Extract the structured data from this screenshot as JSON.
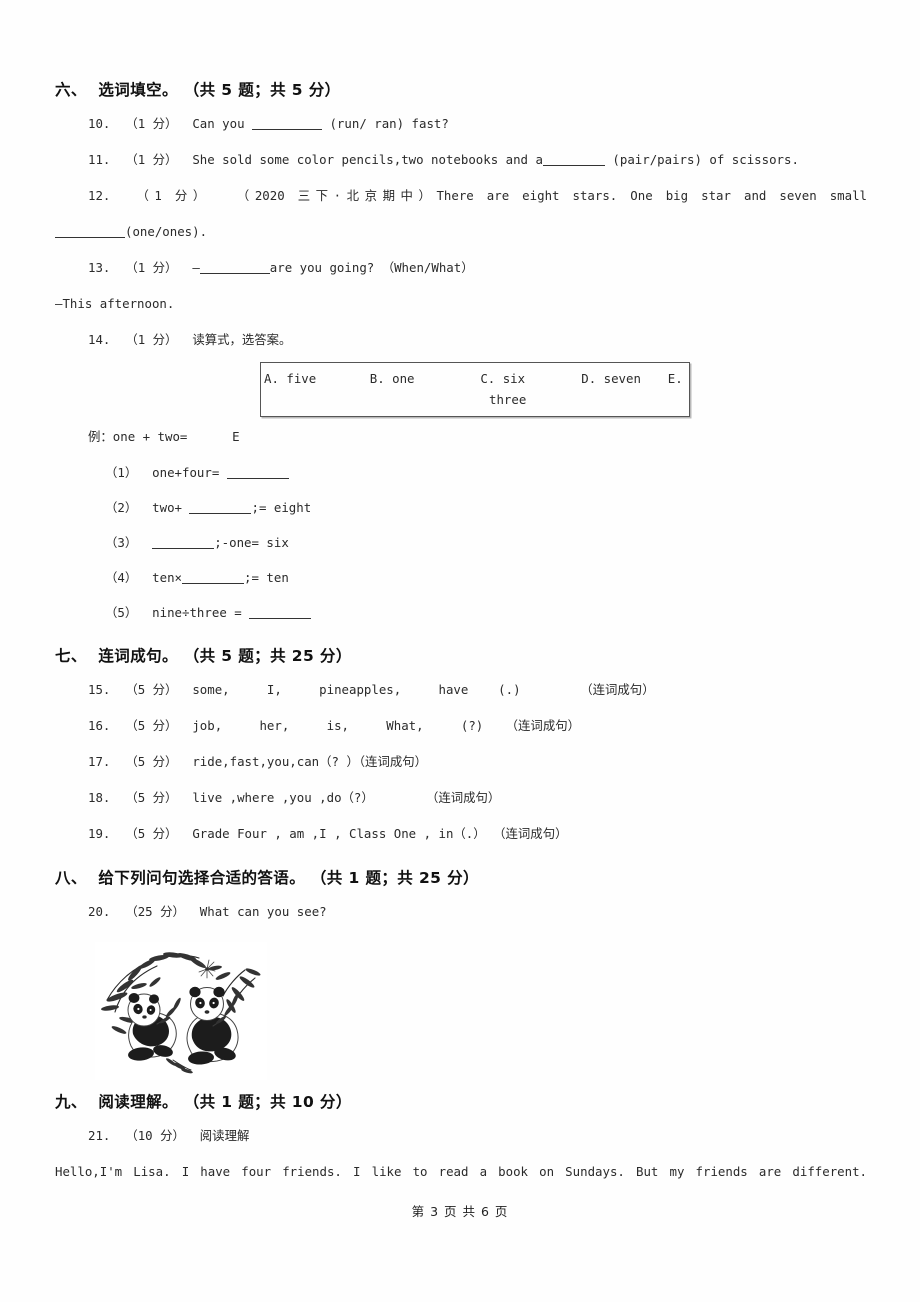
{
  "page": {
    "footer": "第 3 页 共 6 页",
    "number": 3,
    "total": 6
  },
  "sections": [
    {
      "id": "six",
      "number": "六、",
      "title": "选词填空。",
      "meta": "（共 5 题；共 5 分）",
      "heading": "六、  选词填空。 （共 5 题；共 5 分）"
    },
    {
      "id": "seven",
      "number": "七、",
      "title": "连词成句。",
      "meta": "（共 5 题；共 25 分）",
      "heading": "七、  连词成句。 （共 5 题；共 25 分）"
    },
    {
      "id": "eight",
      "number": "八、",
      "title": "给下列问句选择合适的答语。",
      "meta": "（共 1 题；共 25 分）",
      "heading": "八、  给下列问句选择合适的答语。 （共 1 题；共 25 分）"
    },
    {
      "id": "nine",
      "number": "九、",
      "title": "阅读理解。",
      "meta": "（共 1 题；共 10 分）",
      "heading": "九、  阅读理解。 （共 1 题；共 10 分）"
    }
  ],
  "q10": {
    "num": "10.",
    "points": "（1 分）",
    "text_before": "Can you ",
    "text_after": " (run/ ran) fast?"
  },
  "q11": {
    "num": "11.",
    "points": "（1 分）",
    "text_before": "She sold some color pencils,two notebooks and a",
    "text_after": " (pair/pairs) of scissors."
  },
  "q12": {
    "num": "12.",
    "points": "（1 分）",
    "tag": "（2020 三下·北京期中）",
    "line1": "There are eight stars. One big star and seven small",
    "line2_after": "(one/ones)."
  },
  "q13": {
    "num": "13.",
    "points": "（1 分）",
    "dash": "—",
    "text_after": "are you going? （When/What）",
    "answer_line": "—This afternoon."
  },
  "q14": {
    "num": "14.",
    "points": "（1 分）",
    "text": "读算式，选答案。",
    "options": [
      {
        "key": "A.",
        "label": "A. five"
      },
      {
        "key": "B.",
        "label": "B. one"
      },
      {
        "key": "C.",
        "label": "C. six"
      },
      {
        "key": "D.",
        "label": "D. seven"
      },
      {
        "key": "E.",
        "label": "E."
      }
    ],
    "option_wrap": "three",
    "example": "例：one + two=      E",
    "subs": [
      {
        "label": "（1）",
        "before": " one+four= ",
        "after": ""
      },
      {
        "label": "（2）",
        "before": " two+ ",
        "after": ";= eight"
      },
      {
        "label": "（3）",
        "before": " ",
        "after": ";-one= six"
      },
      {
        "label": "（4）",
        "before": " ten×",
        "after": ";= ten"
      },
      {
        "label": "（5）",
        "before": " nine÷three = ",
        "after": ""
      }
    ]
  },
  "q15": {
    "num": "15.",
    "points": "（5 分）",
    "words": "some,     I,     pineapples,     have    (.)",
    "instruction": "（连词成句）"
  },
  "q16": {
    "num": "16.",
    "points": "（5 分）",
    "words": "job,     her,     is,     What,     (?)",
    "instruction": "（连词成句）"
  },
  "q17": {
    "num": "17.",
    "points": "（5 分）",
    "words": "ride,fast,you,can（? ）",
    "instruction": "（连词成句）"
  },
  "q18": {
    "num": "18.",
    "points": "（5 分）",
    "words": "live ,where ,you ,do（?）",
    "instruction": "（连词成句）"
  },
  "q19": {
    "num": "19.",
    "points": "（5 分）",
    "words": "Grade Four , am ,I , Class One , in（.）",
    "instruction": "（连词成句）"
  },
  "q20": {
    "num": "20.",
    "points": "（25 分）",
    "text": "What can you see?",
    "figure_alt": "two pandas eating bamboo ink drawing"
  },
  "q21": {
    "num": "21.",
    "points": "（10 分）",
    "text": "阅读理解",
    "passage": "Hello,I'm Lisa.  I have four friends.  I like to read a book on Sundays.  But my friends are different."
  }
}
